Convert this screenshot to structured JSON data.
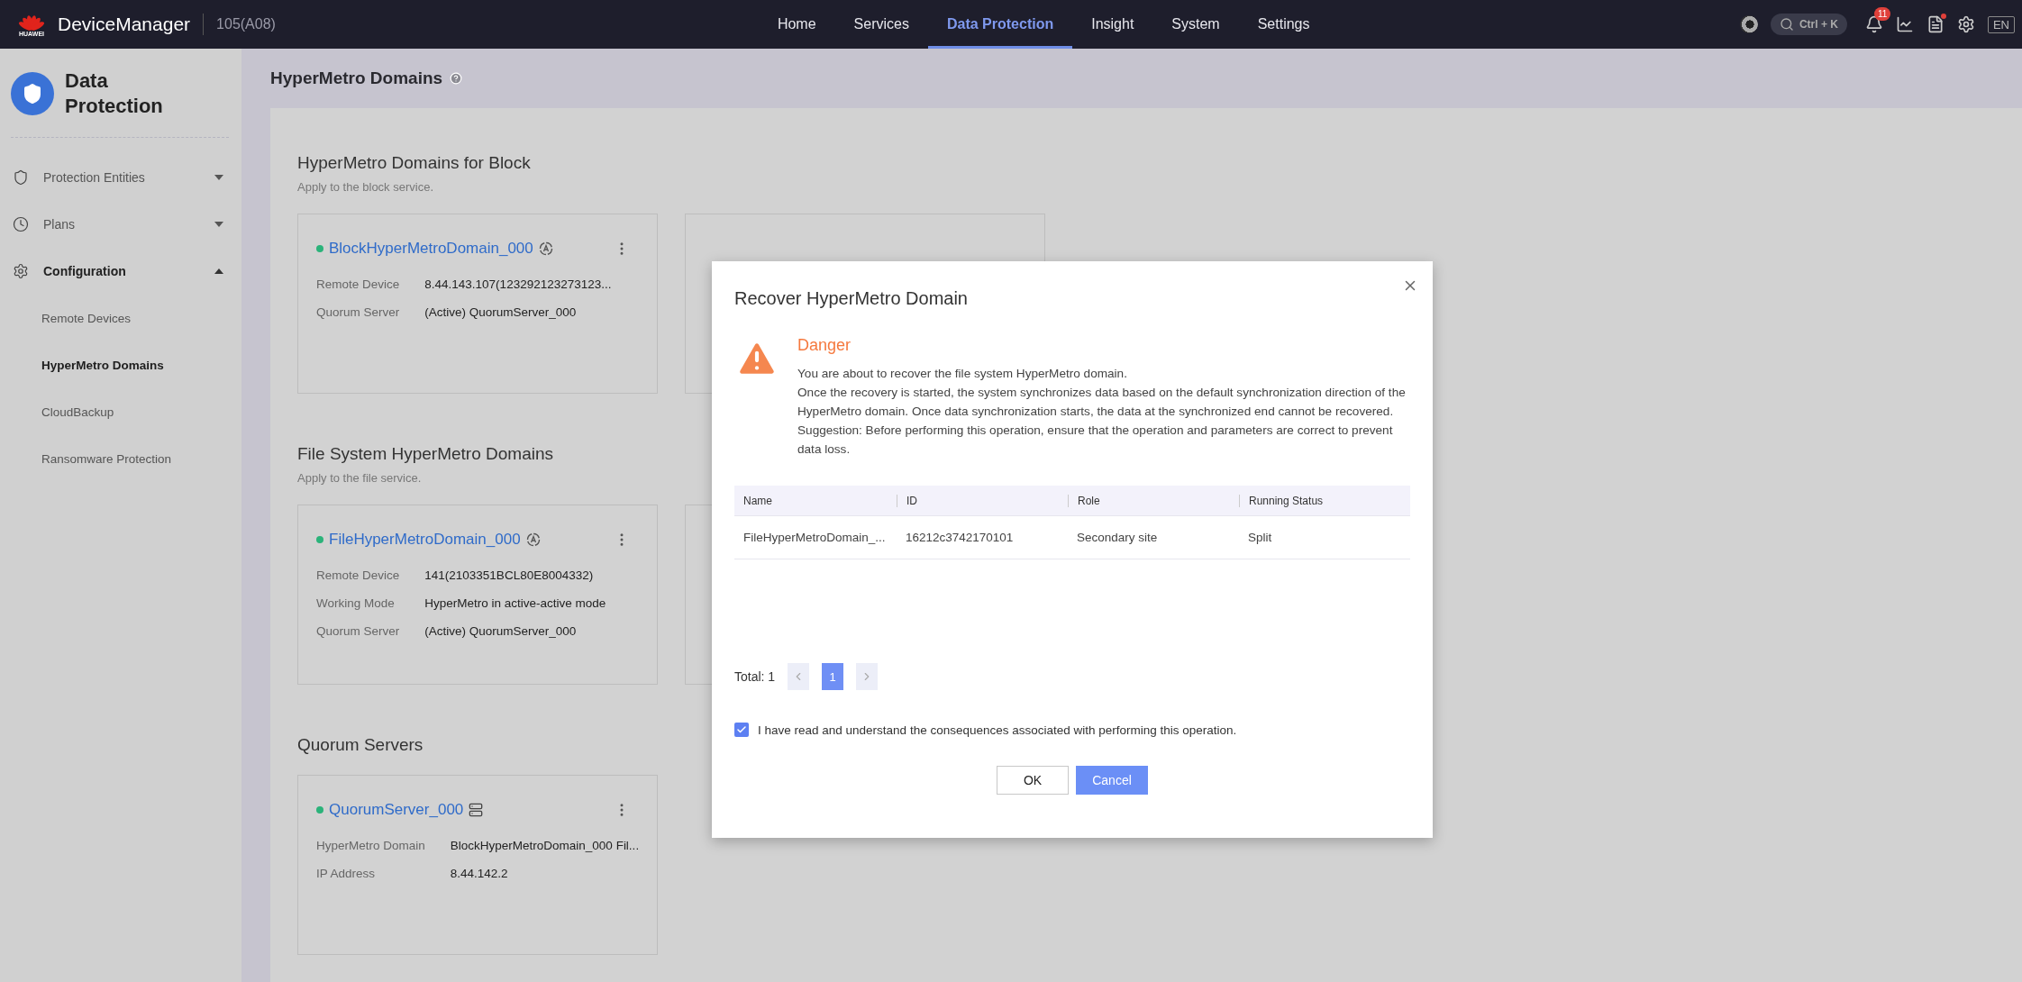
{
  "topbar": {
    "logo_text": "HUAWEI",
    "brand": "DeviceManager",
    "device": "105(A08)",
    "nav": [
      {
        "label": "Home",
        "selected": false
      },
      {
        "label": "Services",
        "selected": false
      },
      {
        "label": "Data Protection",
        "selected": true
      },
      {
        "label": "Insight",
        "selected": false
      },
      {
        "label": "System",
        "selected": false
      },
      {
        "label": "Settings",
        "selected": false
      }
    ],
    "search_hint": "Ctrl + K",
    "notification_count": "11",
    "language": "EN"
  },
  "sidebar": {
    "title": "Data Protection",
    "items": [
      {
        "label": "Protection Entities",
        "kind": "entities",
        "expanded": false
      },
      {
        "label": "Plans",
        "kind": "plans",
        "expanded": false
      },
      {
        "label": "Configuration",
        "kind": "settings",
        "expanded": true,
        "children": [
          {
            "label": "Remote Devices",
            "selected": false
          },
          {
            "label": "HyperMetro Domains",
            "selected": true
          },
          {
            "label": "CloudBackup",
            "selected": false
          },
          {
            "label": "Ransomware Protection",
            "selected": false
          }
        ]
      }
    ]
  },
  "page_title": "HyperMetro Domains",
  "sections": [
    {
      "title": "HyperMetro Domains for Block",
      "subtitle": "Apply to the block service.",
      "cards": [
        {
          "kind": "domain",
          "name": "BlockHyperMetroDomain_000",
          "fields": [
            {
              "label": "Remote Device",
              "value": "8.44.143.107(123292123273123..."
            },
            {
              "label": "Quorum Server",
              "value": "(Active) QuorumServer_000"
            }
          ]
        },
        {
          "kind": "blank"
        }
      ]
    },
    {
      "title": "File System HyperMetro Domains",
      "subtitle": "Apply to the file service.",
      "cards": [
        {
          "kind": "domain",
          "name": "FileHyperMetroDomain_000",
          "fields": [
            {
              "label": "Remote Device",
              "value": "141(2103351BCL80E8004332)"
            },
            {
              "label": "Working Mode",
              "value": "HyperMetro in active-active mode"
            },
            {
              "label": "Quorum Server",
              "value": "(Active) QuorumServer_000"
            }
          ]
        },
        {
          "kind": "blank"
        }
      ]
    },
    {
      "title": "Quorum Servers",
      "cards": [
        {
          "kind": "server",
          "name": "QuorumServer_000",
          "fields": [
            {
              "label": "HyperMetro Domain",
              "value": "BlockHyperMetroDomain_000 Fil..."
            },
            {
              "label": "IP Address",
              "value": "8.44.142.2"
            }
          ]
        }
      ]
    }
  ],
  "dialog": {
    "title": "Recover HyperMetro Domain",
    "alert_title": "Danger",
    "message": [
      "You are about to recover the file system HyperMetro domain.",
      "Once the recovery is started, the system synchronizes data based on the default synchronization direction of the HyperMetro domain. Once data synchronization starts, the data at the synchronized end cannot be recovered.",
      "Suggestion: Before performing this operation, ensure that the operation and parameters are correct to prevent data loss."
    ],
    "table": {
      "columns": [
        "Name",
        "ID",
        "Role",
        "Running Status"
      ],
      "rows": [
        [
          "FileHyperMetroDomain_...",
          "16212c3742170101",
          "Secondary site",
          "Split"
        ]
      ]
    },
    "total": "Total: 1",
    "pages": [
      {
        "label": "1",
        "selected": true
      }
    ],
    "confirm": {
      "label": "I have read and understand the consequences associated with performing this operation.",
      "checked": true
    },
    "buttons": [
      {
        "label": "OK",
        "kind": "secondary"
      },
      {
        "label": "Cancel",
        "kind": "primary"
      }
    ]
  }
}
